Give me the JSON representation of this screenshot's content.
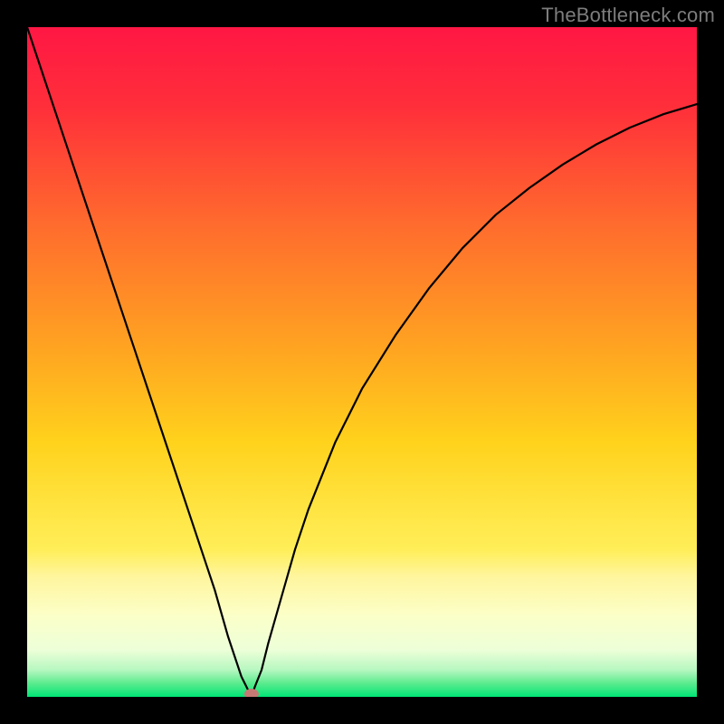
{
  "watermark": "TheBottleneck.com",
  "colors": {
    "frame": "#000000",
    "gradient_top": "#ff1744",
    "gradient_upper": "#ff5722",
    "gradient_mid": "#ffc107",
    "gradient_lower": "#ffee58",
    "gradient_pale": "#f4ffcf",
    "gradient_bottom": "#00e676",
    "curve": "#000000",
    "marker": "#c77a74"
  },
  "chart_data": {
    "type": "line",
    "title": "",
    "xlabel": "",
    "ylabel": "",
    "xlim": [
      0,
      100
    ],
    "ylim": [
      0,
      100
    ],
    "x": [
      0,
      2,
      4,
      6,
      8,
      10,
      12,
      14,
      16,
      18,
      20,
      22,
      24,
      26,
      28,
      30,
      31,
      32,
      33,
      33.5,
      34,
      35,
      36,
      38,
      40,
      42,
      44,
      46,
      48,
      50,
      55,
      60,
      65,
      70,
      75,
      80,
      85,
      90,
      95,
      100
    ],
    "values": [
      100,
      94,
      88,
      82,
      76,
      70,
      64,
      58,
      52,
      46,
      40,
      34,
      28,
      22,
      16,
      9,
      6,
      3,
      1,
      0,
      1.5,
      4,
      8,
      15,
      22,
      28,
      33,
      38,
      42,
      46,
      54,
      61,
      67,
      72,
      76,
      79.5,
      82.5,
      85,
      87,
      88.5
    ],
    "marker": {
      "x": 33.5,
      "y": 0
    },
    "background_bands": [
      {
        "from": 0,
        "to": 78,
        "meaning": "red-to-yellow-gradient"
      },
      {
        "from": 78,
        "to": 97,
        "meaning": "yellow-band"
      },
      {
        "from": 97,
        "to": 100,
        "meaning": "green-band"
      }
    ]
  }
}
